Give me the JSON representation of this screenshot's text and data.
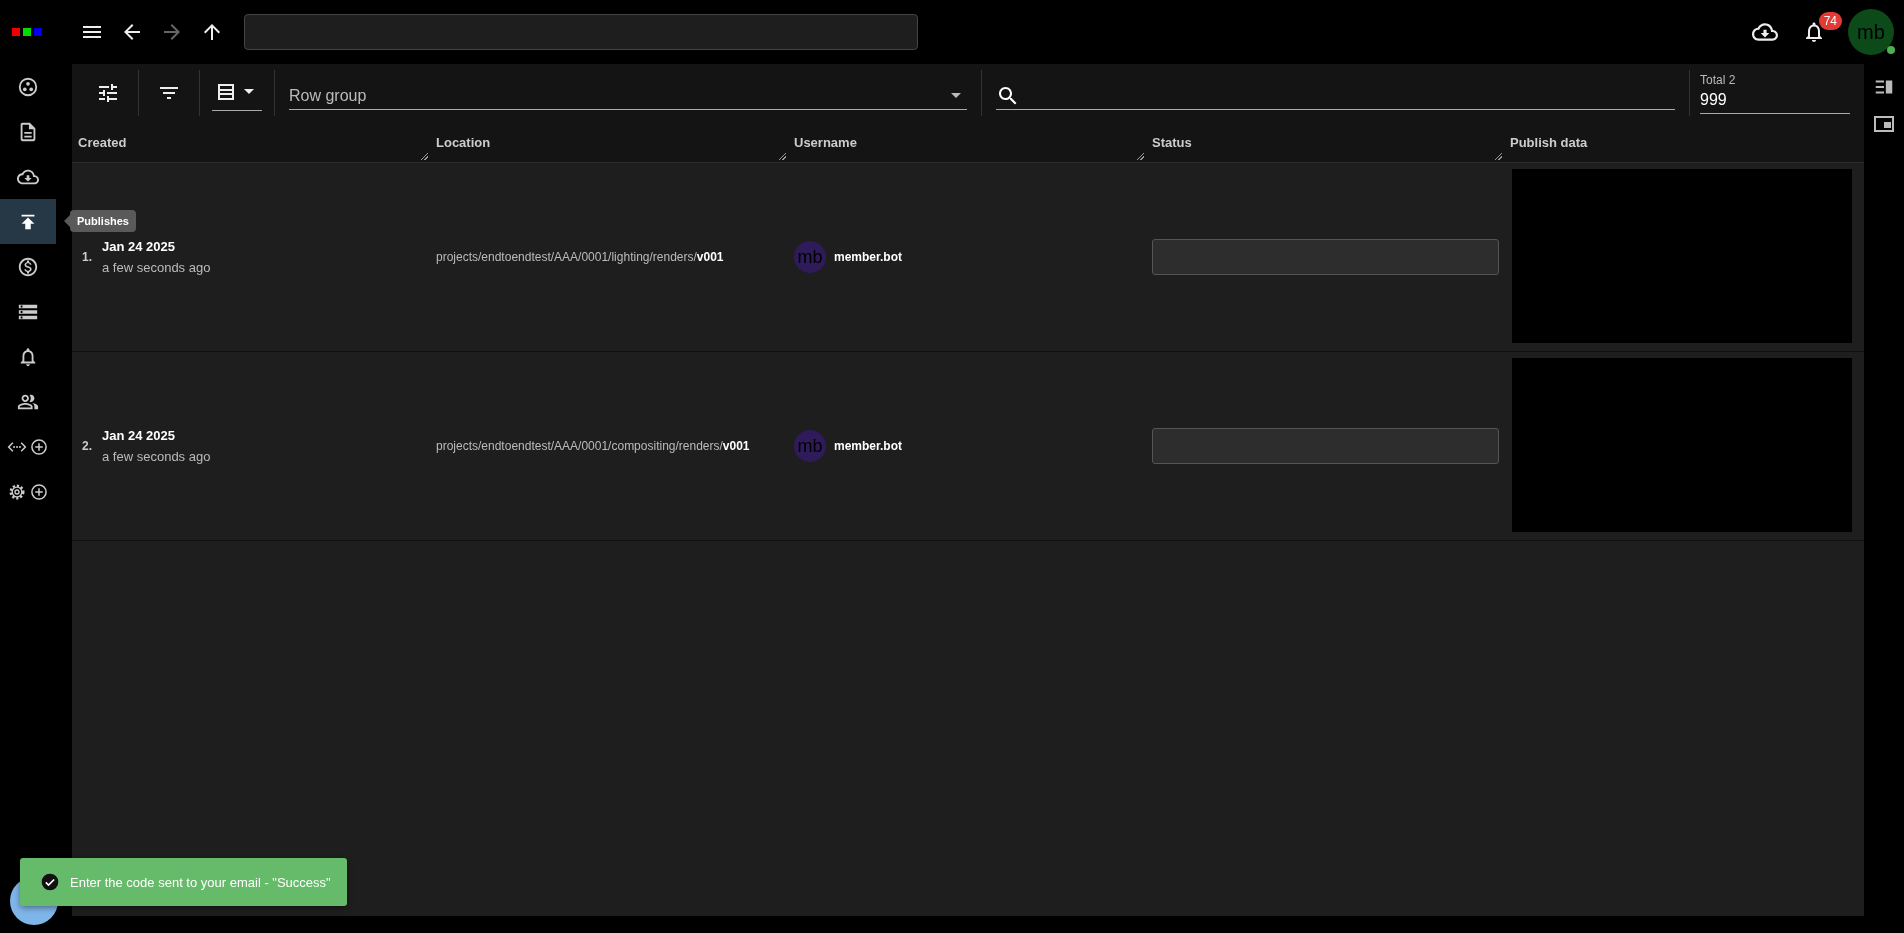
{
  "top_bar": {
    "nav": [
      {
        "kind": "back",
        "disabled": false
      },
      {
        "kind": "forward",
        "disabled": true
      },
      {
        "kind": "up",
        "disabled": false
      }
    ],
    "notifications": {
      "count": "74"
    },
    "avatar": {
      "initials": "mb",
      "online": true
    }
  },
  "sidebar": {
    "items": [
      {
        "kind": "dashboard",
        "selected": false
      },
      {
        "kind": "document",
        "selected": false
      },
      {
        "kind": "cloud",
        "selected": false
      },
      {
        "kind": "publish",
        "selected": true,
        "tooltip": "Publishes"
      },
      {
        "kind": "dollar",
        "selected": false
      },
      {
        "kind": "storage",
        "selected": false
      },
      {
        "kind": "bell",
        "selected": false
      },
      {
        "kind": "people",
        "selected": false
      },
      {
        "kind": "api",
        "selected": false
      },
      {
        "kind": "settings",
        "selected": false
      }
    ]
  },
  "toolbar": {
    "row_group": {
      "placeholder": "Row group"
    },
    "total": {
      "label": "Total 2",
      "value": "999"
    }
  },
  "table": {
    "columns": [
      "Created",
      "Location",
      "Username",
      "Status",
      "Publish data"
    ],
    "rows": [
      {
        "index": "1.",
        "date": "Jan 24 2025",
        "relative": "a few seconds ago",
        "location": "projects/endtoendtest/AAA/0001/lighting/renders/**v001**",
        "user": {
          "initials": "mb",
          "name": "member.bot"
        }
      },
      {
        "index": "2.",
        "date": "Jan 24 2025",
        "relative": "a few seconds ago",
        "location": "projects/endtoendtest/AAA/0001/compositing/renders/**v001**",
        "user": {
          "initials": "mb",
          "name": "member.bot"
        }
      }
    ]
  },
  "toast": {
    "kind": "success",
    "message": "Enter the code sent to your email - \"Success\""
  }
}
